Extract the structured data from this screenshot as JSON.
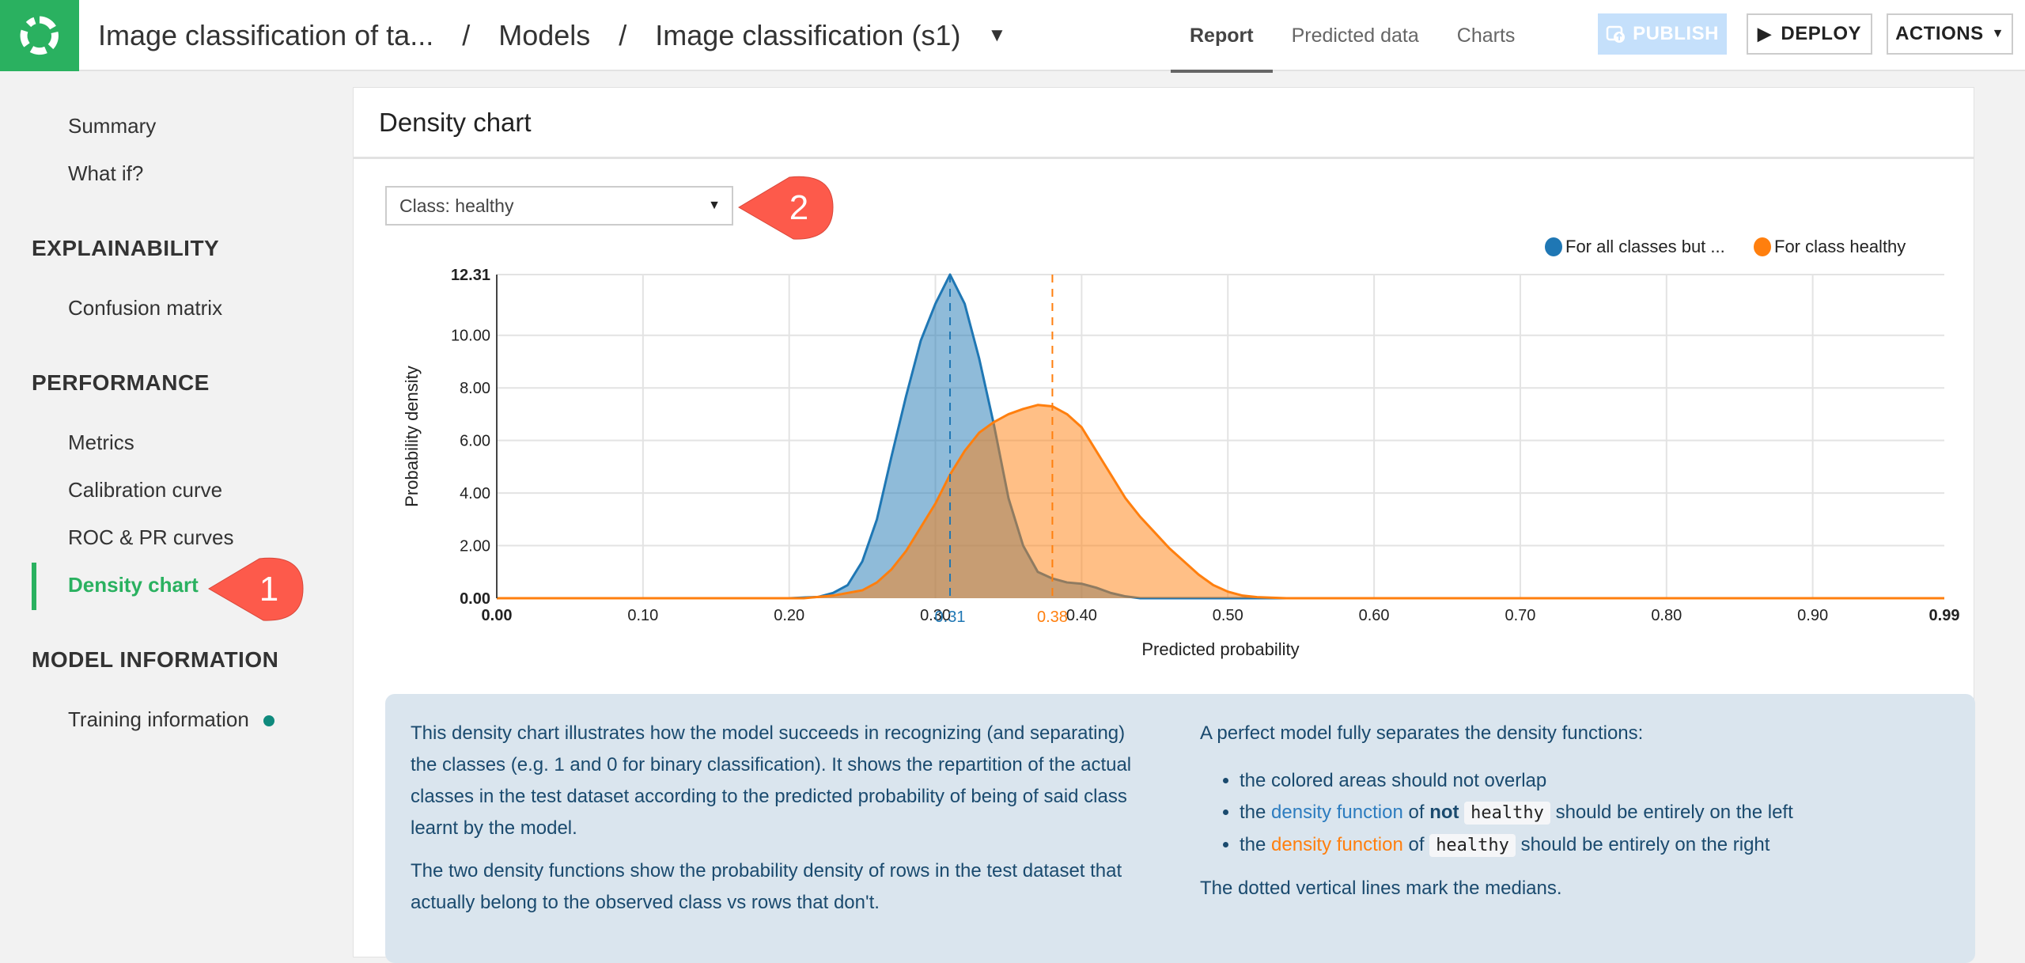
{
  "header": {
    "breadcrumb": [
      "Image classification of ta...",
      "Models",
      "Image classification (s1)"
    ],
    "separator": "/",
    "tabs": [
      {
        "label": "Report",
        "active": true
      },
      {
        "label": "Predicted data",
        "active": false
      },
      {
        "label": "Charts",
        "active": false
      }
    ],
    "publish_label": "PUBLISH",
    "deploy_label": "DEPLOY",
    "actions_label": "ACTIONS"
  },
  "sidebar": {
    "top_items": [
      "Summary",
      "What if?"
    ],
    "sections": [
      {
        "title": "EXPLAINABILITY",
        "items": [
          "Confusion matrix"
        ]
      },
      {
        "title": "PERFORMANCE",
        "items": [
          "Metrics",
          "Calibration curve",
          "ROC & PR curves",
          "Density chart"
        ]
      },
      {
        "title": "MODEL INFORMATION",
        "items": [
          "Training information"
        ]
      }
    ],
    "active_item": "Density chart"
  },
  "callouts": {
    "one": "1",
    "two": "2"
  },
  "panel": {
    "title": "Density chart",
    "class_select": "Class: healthy"
  },
  "chart_data": {
    "type": "area",
    "title": "",
    "xlabel": "Predicted probability",
    "ylabel": "Probability density",
    "xlim": [
      0.0,
      0.99
    ],
    "ylim": [
      0.0,
      12.31
    ],
    "x_ticks": [
      "0.00",
      "0.10",
      "0.20",
      "0.30",
      "0.40",
      "0.50",
      "0.60",
      "0.70",
      "0.80",
      "0.90",
      "0.99"
    ],
    "y_ticks": [
      "0.00",
      "2.00",
      "4.00",
      "6.00",
      "8.00",
      "10.00",
      "12.31"
    ],
    "grid": true,
    "legend_position": "top-right",
    "series": [
      {
        "name": "For all classes but ...",
        "color": "#1f77b4",
        "median": 0.31,
        "median_label": "0.31",
        "x": [
          0.0,
          0.2,
          0.22,
          0.23,
          0.24,
          0.25,
          0.26,
          0.27,
          0.28,
          0.29,
          0.3,
          0.31,
          0.32,
          0.33,
          0.34,
          0.35,
          0.36,
          0.37,
          0.38,
          0.39,
          0.4,
          0.41,
          0.42,
          0.43,
          0.44,
          0.99
        ],
        "y": [
          0.0,
          0.0,
          0.05,
          0.2,
          0.5,
          1.4,
          3.0,
          5.4,
          7.7,
          9.8,
          11.2,
          12.31,
          11.2,
          9.1,
          6.6,
          3.8,
          2.0,
          1.0,
          0.75,
          0.6,
          0.55,
          0.4,
          0.2,
          0.07,
          0.0,
          0.0
        ]
      },
      {
        "name": "For class healthy",
        "color": "#ff7f0e",
        "median": 0.38,
        "median_label": "0.38",
        "x": [
          0.0,
          0.21,
          0.23,
          0.25,
          0.26,
          0.27,
          0.28,
          0.29,
          0.3,
          0.31,
          0.32,
          0.33,
          0.34,
          0.35,
          0.36,
          0.37,
          0.38,
          0.39,
          0.4,
          0.41,
          0.42,
          0.43,
          0.44,
          0.45,
          0.46,
          0.47,
          0.48,
          0.49,
          0.5,
          0.51,
          0.52,
          0.54,
          0.99
        ],
        "y": [
          0.0,
          0.0,
          0.1,
          0.3,
          0.6,
          1.1,
          1.8,
          2.7,
          3.6,
          4.7,
          5.6,
          6.3,
          6.7,
          7.0,
          7.2,
          7.35,
          7.3,
          7.0,
          6.5,
          5.6,
          4.7,
          3.8,
          3.1,
          2.5,
          1.9,
          1.4,
          0.9,
          0.5,
          0.25,
          0.1,
          0.04,
          0.0,
          0.0
        ]
      }
    ]
  },
  "info": {
    "p1": "This density chart illustrates how the model succeeds in recognizing (and separating) the classes (e.g. 1 and 0 for binary classification). It shows the repartition of the actual classes in the test dataset according to the predicted probability of being of said class learnt by the model.",
    "p2": "The two density functions show the probability density of rows in the test dataset that actually belong to the observed class vs rows that don't.",
    "intro": "A perfect model fully separates the density functions:",
    "bullet1": "the colored areas should not overlap",
    "the": "the",
    "link": "density function",
    "of": "of",
    "not": "not",
    "class_code": "healthy",
    "left_tail": "should be entirely on the left",
    "right_tail": "should be entirely on the right",
    "outro": "The dotted vertical lines mark the medians."
  }
}
